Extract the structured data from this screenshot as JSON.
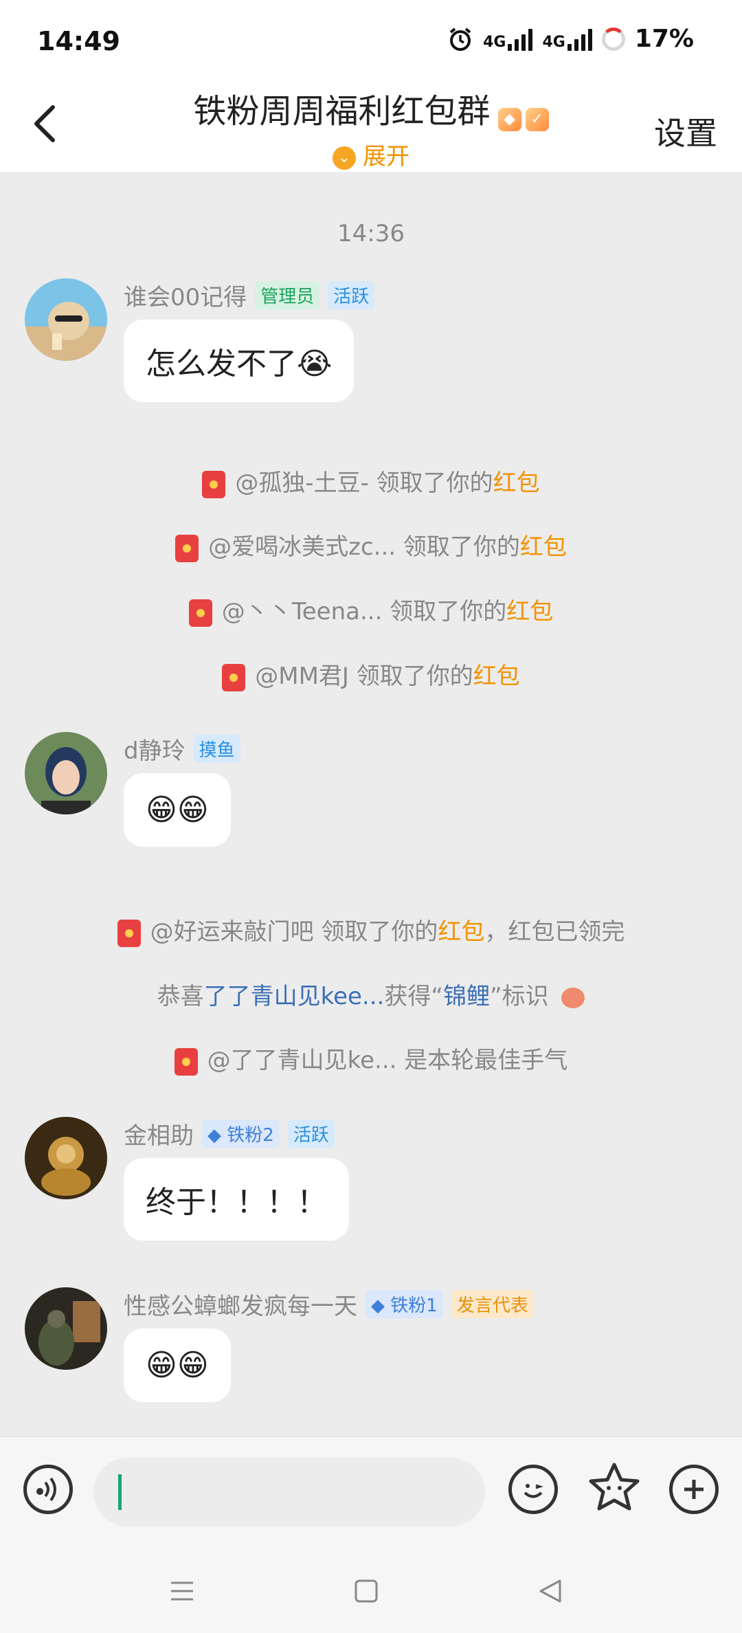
{
  "status_bar": {
    "time": "14:49",
    "network1": "4G",
    "network2": "4G",
    "battery": "17%"
  },
  "header": {
    "title": "铁粉周周福利红包群",
    "expand_label": "展开",
    "settings_label": "设置",
    "accent_color": "#f39200"
  },
  "chat": {
    "time_divider": "14:36",
    "messages": [
      {
        "sender": "谁会00记得",
        "tags": [
          "管理员",
          "活跃"
        ],
        "text": "怎么发不了😭"
      },
      {
        "sender": "d静玲",
        "tags": [
          "摸鱼"
        ],
        "text": "😁😁"
      },
      {
        "sender": "金相助",
        "tags": [
          "铁粉2",
          "活跃"
        ],
        "text": "终于！！！！"
      },
      {
        "sender": "性感公蟑螂发疯每一天",
        "tags": [
          "铁粉1",
          "发言代表"
        ],
        "text": "😁😁"
      }
    ],
    "system": [
      {
        "pre": "@孤独-土豆- 领取了你的",
        "hl": "红包",
        "post": ""
      },
      {
        "pre": "@爱喝冰美式zc... 领取了你的",
        "hl": "红包",
        "post": ""
      },
      {
        "pre": "@丶丶Teena... 领取了你的",
        "hl": "红包",
        "post": ""
      },
      {
        "pre": "@MM君J 领取了你的",
        "hl": "红包",
        "post": ""
      },
      {
        "pre": "@好运来敲门吧 领取了你的",
        "hl": "红包",
        "post": "，红包已领完"
      },
      {
        "pre": "恭喜",
        "user": "了了青山见kee...",
        "mid": "获得“",
        "badge": "锦鲤",
        "post": "”标识"
      },
      {
        "pre": "@了了青山见ke... 是本轮最佳手气",
        "hl": "",
        "post": ""
      }
    ]
  },
  "input": {
    "placeholder": ""
  }
}
